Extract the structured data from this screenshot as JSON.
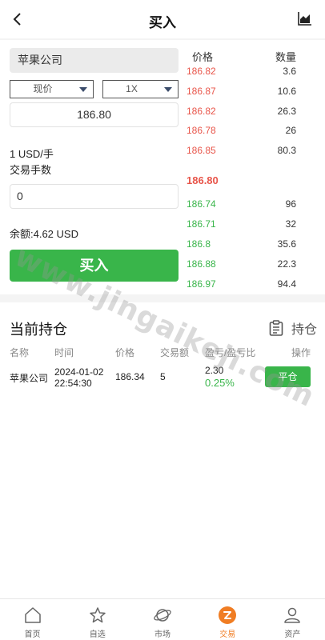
{
  "header": {
    "title": "买入"
  },
  "trade": {
    "stock_name": "苹果公司",
    "order_type": "现价",
    "leverage": "1X",
    "price": "186.80",
    "lot_info": "1 USD/手",
    "fee_label": "交易手数",
    "quantity": "0",
    "balance": "余额:4.62 USD",
    "buy_label": "买入"
  },
  "order_book": {
    "price_header": "价格",
    "qty_header": "数量",
    "asks": [
      {
        "price": "186.82",
        "qty": "3.6"
      },
      {
        "price": "186.87",
        "qty": "10.6"
      },
      {
        "price": "186.82",
        "qty": "26.3"
      },
      {
        "price": "186.78",
        "qty": "26"
      },
      {
        "price": "186.85",
        "qty": "80.3"
      }
    ],
    "mid_price": "186.80",
    "bids": [
      {
        "price": "186.74",
        "qty": "96"
      },
      {
        "price": "186.71",
        "qty": "32"
      },
      {
        "price": "186.8",
        "qty": "35.6"
      },
      {
        "price": "186.88",
        "qty": "22.3"
      },
      {
        "price": "186.97",
        "qty": "94.4"
      }
    ]
  },
  "positions": {
    "title": "当前持仓",
    "link_label": "持仓",
    "columns": {
      "name": "名称",
      "time": "时间",
      "price": "价格",
      "amount": "交易额",
      "pnl": "盈亏/盈亏比",
      "action": "操作"
    },
    "row": {
      "name": "苹果公司",
      "date": "2024-01-02",
      "time": "22:54:30",
      "price": "186.34",
      "amount": "5",
      "pnl": "2.30",
      "pnl_ratio": "0.25%",
      "action_label": "平仓"
    }
  },
  "watermark": "www.jingaikeji.com",
  "nav": {
    "items": [
      {
        "label": "首页",
        "icon": "home-icon"
      },
      {
        "label": "自选",
        "icon": "star-icon"
      },
      {
        "label": "市场",
        "icon": "planet-icon"
      },
      {
        "label": "交易",
        "icon": "trade-icon"
      },
      {
        "label": "资产",
        "icon": "user-icon"
      }
    ],
    "active_color": "#f07d23"
  },
  "colors": {
    "up": "#39b54a",
    "down": "#e8554a",
    "accent": "#f07d23"
  }
}
